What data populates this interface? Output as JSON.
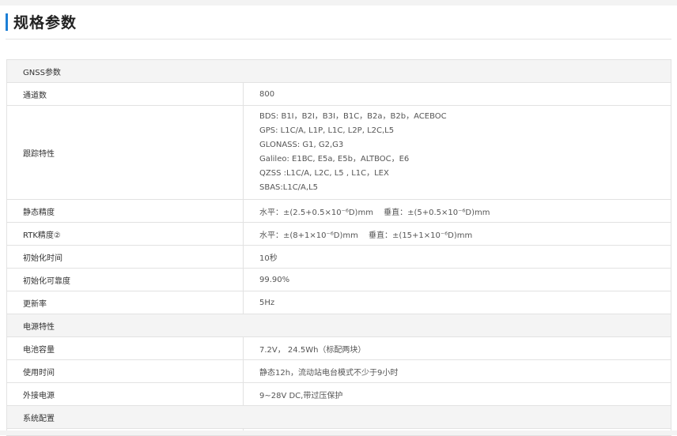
{
  "page": {
    "title": "规格参数"
  },
  "table": {
    "sections": [
      {
        "name": "GNSS参数",
        "rows": [
          {
            "label": "通道数",
            "value": "800"
          },
          {
            "label": "跟踪特性",
            "lines": [
              "BDS: B1I，B2I，B3I，B1C，B2a，B2b，ACEBOC",
              "GPS: L1C/A, L1P, L1C, L2P, L2C,L5",
              "GLONASS: G1, G2,G3",
              "Galileo: E1BC, E5a, E5b，ALTBOC，E6",
              "QZSS :L1C/A, L2C, L5 , L1C，LEX",
              "SBAS:L1C/A,L5"
            ]
          },
          {
            "label": "静态精度",
            "value": "水平：±(2.5+0.5×10⁻⁶D)mm　 垂直：±(5+0.5×10⁻⁶D)mm"
          },
          {
            "label": "RTK精度②",
            "value": "水平：±(8+1×10⁻⁶D)mm　 垂直：±(15+1×10⁻⁶D)mm"
          },
          {
            "label": "初始化时间",
            "value": "10秒"
          },
          {
            "label": "初始化可靠度",
            "value": "99.90%"
          },
          {
            "label": "更新率",
            "value": "5Hz"
          }
        ]
      },
      {
        "name": "电源特性",
        "rows": [
          {
            "label": "电池容量",
            "value": "7.2V， 24.5Wh（标配两块）"
          },
          {
            "label": "使用时间",
            "value": "静态12h，流动站电台模式不少于9小时"
          },
          {
            "label": "外接电源",
            "value": "9~28V DC,带过压保护"
          }
        ]
      },
      {
        "name": "系统配置",
        "rows": []
      }
    ]
  }
}
